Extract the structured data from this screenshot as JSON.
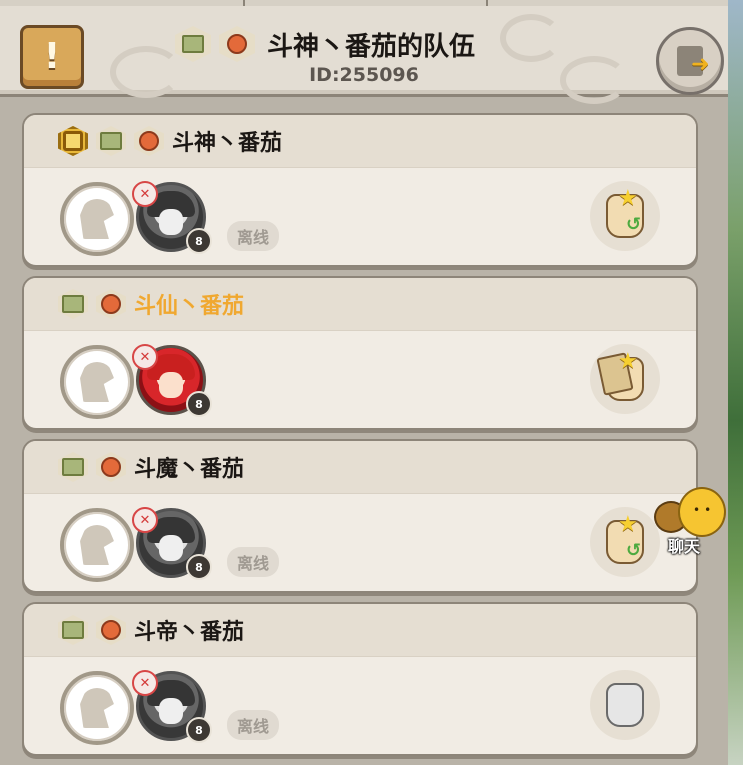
{
  "header": {
    "title": "斗神丶番茄的队伍",
    "id_text": "ID:255096",
    "notice_icon": "exclamation-scroll-icon",
    "exit_icon": "exit-door-icon"
  },
  "members": [
    {
      "name": "斗神丶番茄",
      "badges": [
        "gold-rank-badge-icon",
        "green-guild-badge-icon",
        "red-class-badge-icon"
      ],
      "avatar": "grey",
      "level": "8",
      "status": "离线",
      "action_icon": "swap-hand-icon",
      "is_self": false
    },
    {
      "name": "斗仙丶番茄",
      "badges": [
        "green-guild-badge-icon",
        "red-class-badge-icon"
      ],
      "avatar": "red",
      "level": "8",
      "status": "",
      "action_icon": "card-hand-icon",
      "is_self": true
    },
    {
      "name": "斗魔丶番茄",
      "badges": [
        "green-guild-badge-icon",
        "red-class-badge-icon"
      ],
      "avatar": "grey",
      "level": "8",
      "status": "离线",
      "action_icon": "swap-hand-icon",
      "is_self": false
    },
    {
      "name": "斗帝丶番茄",
      "badges": [
        "green-guild-badge-icon",
        "red-class-badge-icon"
      ],
      "avatar": "grey",
      "level": "8",
      "status": "离线",
      "action_icon": "grey-hand-icon",
      "is_self": false
    }
  ],
  "chat": {
    "label": "聊天"
  },
  "colors": {
    "self_name": "#f0a830",
    "name": "#1b1714",
    "panel": "#f1ece4"
  }
}
